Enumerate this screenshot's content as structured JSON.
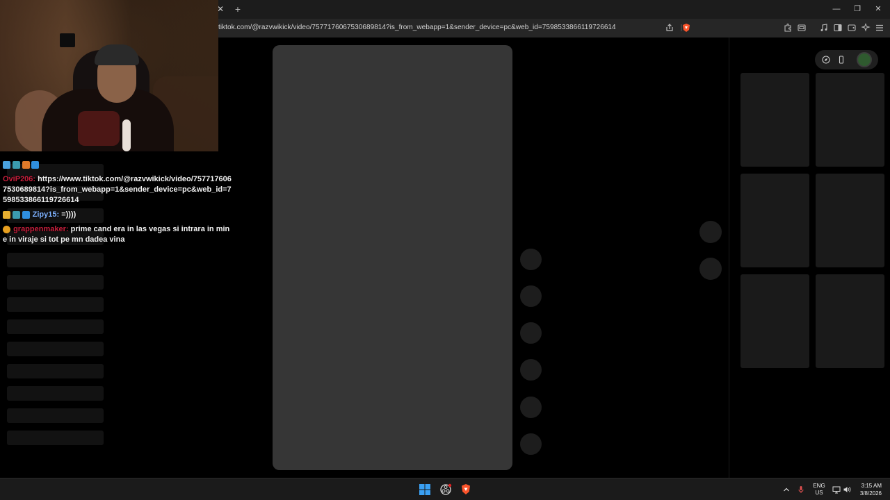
{
  "browser": {
    "url": "tiktok.com/@razvwikick/video/7577176067530689814?is_from_webapp=1&sender_device=pc&web_id=7598533866119726614",
    "tab_close_glyph": "✕",
    "tab_new_glyph": "+",
    "window_controls": [
      "—",
      "❐",
      "✕"
    ],
    "brave_color": "#fb542b"
  },
  "chat": {
    "messages": [
      {
        "username": "",
        "username_color": "#ffffff",
        "text": "",
        "badges": [
          "sword-badge",
          "grid-badge",
          "gear-badge",
          "cube-badge"
        ]
      },
      {
        "username": "OviP206:",
        "username_color": "#c81e3c",
        "text": "https://www.tiktok.com/@razvwikick/video/7577176067530689814?is_from_webapp=1&sender_device=pc&web_id=7598533866119726614",
        "badges": []
      },
      {
        "username": "Zipy15:",
        "username_color": "#7fb2ff",
        "text": "=))))",
        "badges": [
          "crown-badge",
          "grid-badge",
          "cube-badge"
        ]
      },
      {
        "username": "grappenmaker:",
        "username_color": "#c81e3c",
        "text": "prime cand era in las vegas si intrara in mine in viraje si tot pe mn dadea vina",
        "badges": [
          "coin-badge"
        ]
      }
    ]
  },
  "taskbar": {
    "lang_line1": "ENG",
    "lang_line2": "US",
    "time": "3:15 AM",
    "date": "3/8/2026"
  }
}
